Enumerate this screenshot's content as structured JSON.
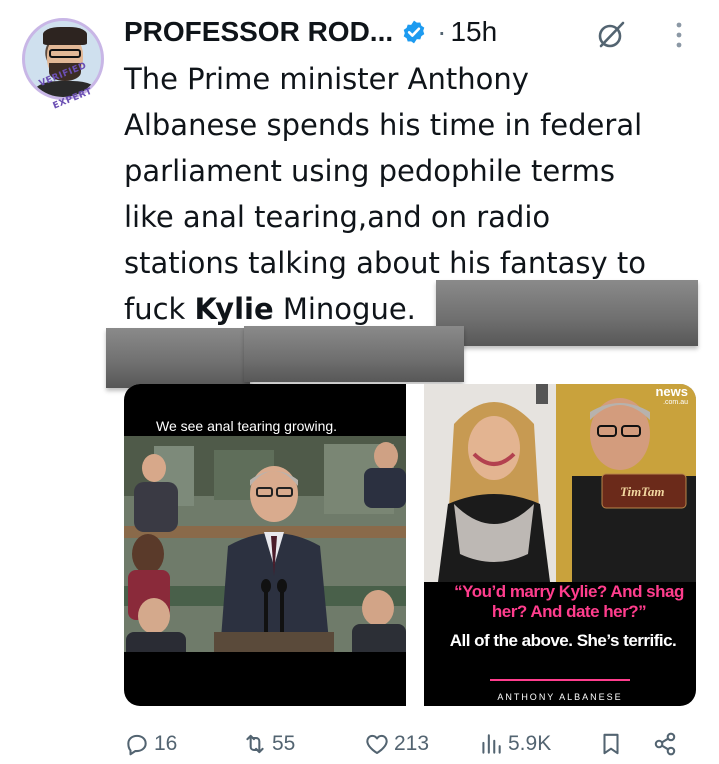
{
  "tweet": {
    "author_name": "PROFESSOR ROD...",
    "separator": "·",
    "time": "15h",
    "avatar_badge": "VERIFIED EXPERT",
    "text_lines": [
      "The Prime minister Anthony",
      "Albanese spends his time in federal",
      "parliament using pedophile terms",
      "like anal tearing,and on radio",
      "stations talking about his fantasy to"
    ],
    "last_line_before": "fuck ",
    "last_line_bold": "Kylie",
    "last_line_after": " Minogue."
  },
  "media": {
    "left_caption": "We see anal tearing growing.",
    "right_logo_top": "news",
    "right_logo_bottom": ".com.au",
    "biscuit_label": "TimTam",
    "quote_pink": "“You’d marry Kylie? And shag her? And date her?”",
    "quote_white": "All of the above. She’s terrific.",
    "attribution": "ANTHONY ALBANESE"
  },
  "actions": {
    "replies": "16",
    "reposts": "55",
    "likes": "213",
    "views": "5.9K"
  },
  "colors": {
    "text": "#0f1419",
    "muted": "#536471",
    "verified_blue": "#1d9bf0",
    "pink": "#ff3d8d"
  },
  "icons": [
    "verified-badge-icon",
    "grok-icon",
    "more-icon",
    "reply-icon",
    "repost-icon",
    "like-icon",
    "views-icon",
    "bookmark-icon",
    "share-icon"
  ]
}
